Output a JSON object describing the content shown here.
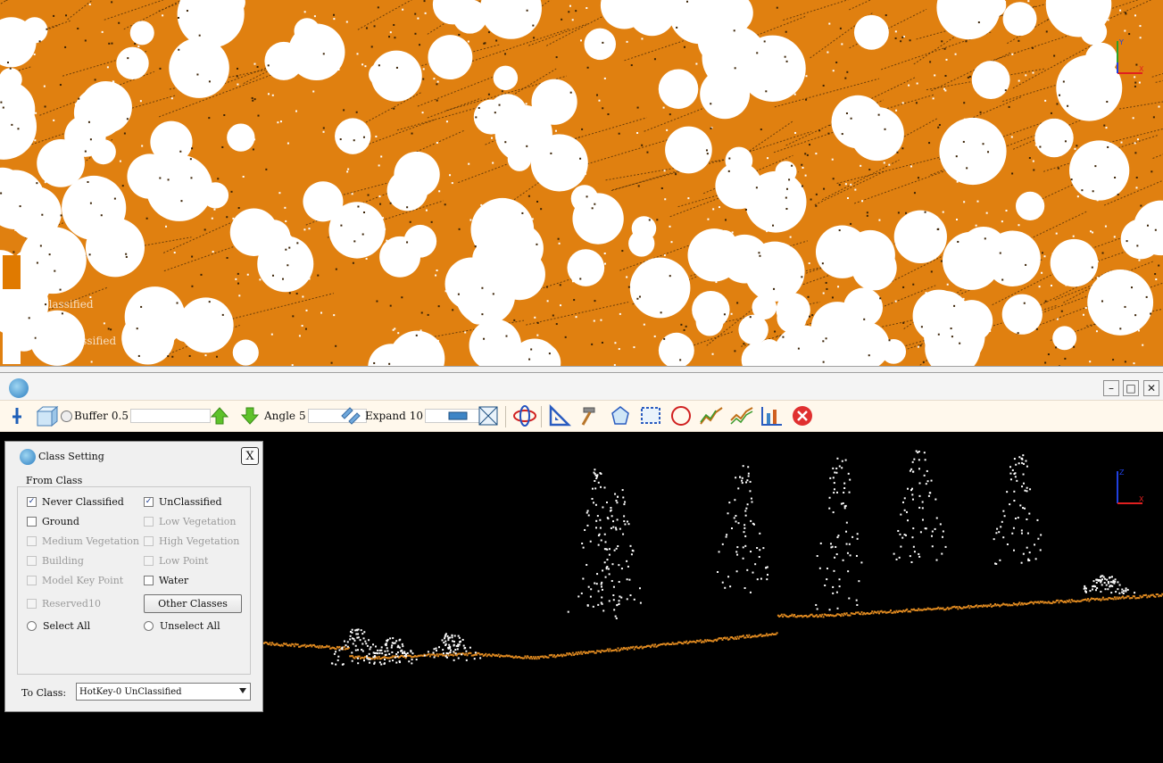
{
  "top_view": {
    "legend": [
      {
        "label": "Unclassified",
        "color": "#e07a00"
      },
      {
        "label": "Never Classified",
        "color": "#ffffff"
      }
    ]
  },
  "window_controls": {
    "minimize": "–",
    "maximize": "□",
    "close": "✕"
  },
  "toolbar": {
    "buffer_label": "Buffer",
    "buffer_value": "0.5",
    "angle_label": "Angle",
    "angle_value": "5",
    "expand_label": "Expand",
    "expand_value": "10",
    "icons": [
      "pin-icon",
      "cube-icon",
      "arrow-up-icon",
      "arrow-down-icon",
      "expand-icon",
      "profile-bar-icon",
      "frame-icon",
      "orbit-icon",
      "ruler-triangle-icon",
      "hammer-icon",
      "polygon-icon",
      "rectangle-select-icon",
      "circle-select-icon",
      "line-up-icon",
      "line-down-icon",
      "chart-icon",
      "stop-icon"
    ]
  },
  "dialog": {
    "title": "Class Setting",
    "close_label": "X",
    "group_title": "From Class",
    "classes": [
      {
        "label": "Never Classified",
        "checked": true,
        "enabled": true
      },
      {
        "label": "UnClassified",
        "checked": true,
        "enabled": true
      },
      {
        "label": "Ground",
        "checked": false,
        "enabled": true
      },
      {
        "label": "Low Vegetation",
        "checked": false,
        "enabled": false
      },
      {
        "label": "Medium Vegetation",
        "checked": false,
        "enabled": false
      },
      {
        "label": "High Vegetation",
        "checked": false,
        "enabled": false
      },
      {
        "label": "Building",
        "checked": false,
        "enabled": false
      },
      {
        "label": "Low Point",
        "checked": false,
        "enabled": false
      },
      {
        "label": "Model Key Point",
        "checked": false,
        "enabled": false
      },
      {
        "label": "Water",
        "checked": false,
        "enabled": true
      },
      {
        "label": "Reserved10",
        "checked": false,
        "enabled": false
      }
    ],
    "other_classes_button": "Other Classes",
    "select_all": "Select All",
    "unselect_all": "Unselect All",
    "to_class_label": "To  Class:",
    "to_class_value": "HotKey-0  UnClassified"
  },
  "colors": {
    "ground_points": "#e08a20",
    "background": "#000000",
    "accent": "#e07a00"
  }
}
